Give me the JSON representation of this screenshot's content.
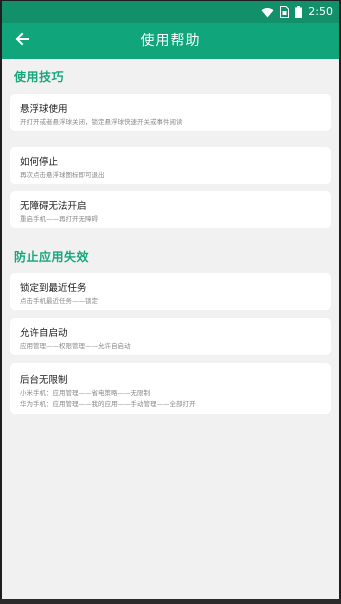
{
  "status_bar": {
    "time": "2:50",
    "icons": [
      "wifi-icon",
      "sim-icon",
      "battery-icon"
    ]
  },
  "toolbar": {
    "title": "使用帮助",
    "back_icon": "arrow-left-icon"
  },
  "sections": [
    {
      "title": "使用技巧",
      "cards": [
        {
          "title": "悬浮球使用",
          "desc": "开打开或者悬浮球关闭，锁定悬浮球快速开关或事件阅读"
        },
        {
          "title": "如何停止",
          "desc": "再次点击悬浮球图标即可退出"
        },
        {
          "title": "无障碍无法开启",
          "desc": "重启手机——再打开无障碍"
        }
      ]
    },
    {
      "title": "防止应用失效",
      "cards": [
        {
          "title": "锁定到最近任务",
          "desc": "点击手机最近任务——锁定"
        },
        {
          "title": "允许自启动",
          "desc": "应用管理——权限管理——允许自启动"
        },
        {
          "title": "后台无限制",
          "desc": "小米手机：应用管理——省电策略——无限制",
          "desc2": "华为手机：应用管理——我的应用——手动管理——全部打开"
        }
      ]
    }
  ],
  "colors": {
    "status_bar": "#11906a",
    "toolbar": "#11a57b",
    "accent": "#16a77c",
    "background": "#f1f1f1"
  }
}
